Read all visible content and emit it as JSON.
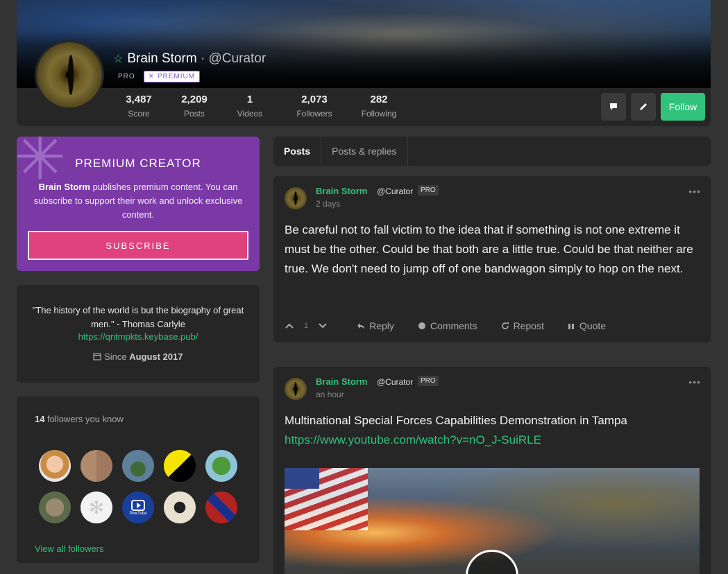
{
  "profile": {
    "display_name": "Brain Storm",
    "separator": "·",
    "handle": "@Curator",
    "badge_pro": "PRO",
    "badge_premium": "✳ PREMIUM"
  },
  "stats": [
    {
      "value": "3,487",
      "label": "Score"
    },
    {
      "value": "2,209",
      "label": "Posts"
    },
    {
      "value": "1",
      "label": "Videos"
    },
    {
      "value": "2,073",
      "label": "Followers"
    },
    {
      "value": "282",
      "label": "Following"
    }
  ],
  "header_actions": {
    "follow_label": "Follow"
  },
  "premium_card": {
    "title": "PREMIUM CREATOR",
    "name": "Brain Storm",
    "desc": " publishes premium content. You can subscribe to support their work and unlock exclusive content.",
    "subscribe_label": "SUBSCRIBE"
  },
  "bio": {
    "quote": "\"The history of the world is but the biography of great men.\" - Thomas Carlyle",
    "link": "https://qntmpkts.keybase.pub/",
    "since_prefix": "Since ",
    "since_date": "August 2017"
  },
  "followers_known": {
    "count": "14",
    "label": " followers you know",
    "view_all": "View all followers",
    "pewtube_label": "PewTube"
  },
  "tabs": [
    {
      "label": "Posts"
    },
    {
      "label": "Posts & replies"
    }
  ],
  "posts": [
    {
      "author": "Brain Storm",
      "handle": "@Curator",
      "badge": "PRO",
      "time": "2 days",
      "text": "Be careful not to fall victim to the idea that if something is not one extreme it must be the other. Could be that both are a little true. Could be that neither are true. We don't need to jump off of one bandwagon simply to hop on the next.",
      "upvotes": "1",
      "actions": {
        "reply": "Reply",
        "comments": "Comments",
        "repost": "Repost",
        "quote": "Quote"
      }
    },
    {
      "author": "Brain Storm",
      "handle": "@Curator",
      "badge": "PRO",
      "time": "an hour",
      "text": "Multinational Special Forces Capabilities Demonstration in Tampa",
      "url": "https://www.youtube.com/watch?v=nO_J-SuiRLE"
    }
  ],
  "colors": {
    "accent": "#31c27c",
    "premium": "#7b39a6",
    "subscribe": "#e0427e",
    "card_bg": "#262626",
    "page_bg": "#333333"
  },
  "icons": {
    "name_star": "star-icon",
    "message": "chat-icon",
    "edit": "pencil-icon",
    "calendar": "calendar-icon",
    "upvote": "chevron-up-icon",
    "downvote": "chevron-down-icon",
    "reply": "reply-icon",
    "comments": "comment-icon",
    "repost": "repost-icon",
    "quote": "quote-icon",
    "more": "more-icon",
    "play": "play-icon"
  }
}
